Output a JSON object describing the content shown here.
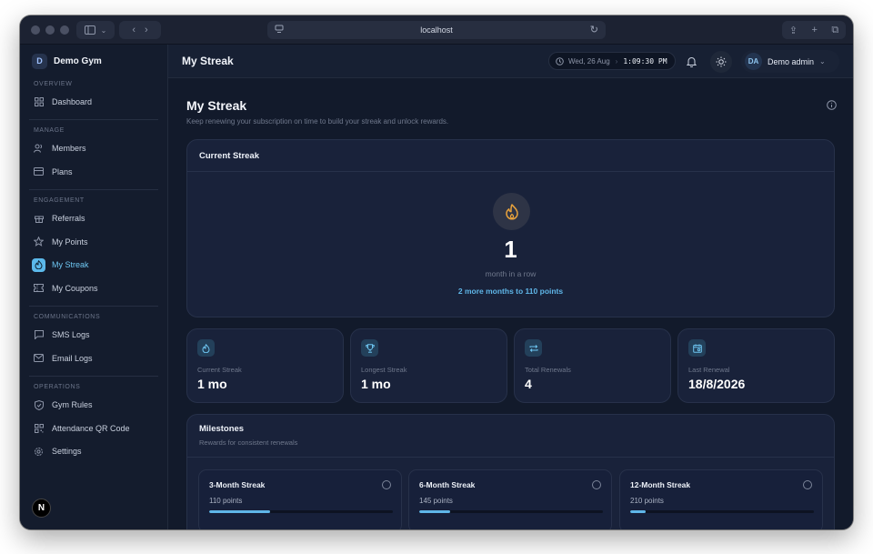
{
  "browser": {
    "url": "localhost"
  },
  "sidebar": {
    "brand_initial": "D",
    "brand_name": "Demo Gym",
    "sections": {
      "overview": "OVERVIEW",
      "manage": "MANAGE",
      "engagement": "ENGAGEMENT",
      "communications": "COMMUNICATIONS",
      "operations": "OPERATIONS"
    },
    "items": {
      "dashboard": "Dashboard",
      "members": "Members",
      "plans": "Plans",
      "referrals": "Referrals",
      "my_points": "My Points",
      "my_streak": "My Streak",
      "my_coupons": "My Coupons",
      "sms_logs": "SMS Logs",
      "email_logs": "Email Logs",
      "gym_rules": "Gym Rules",
      "attendance_qr": "Attendance QR Code",
      "settings": "Settings"
    },
    "active_item": "My Streak",
    "footer_avatar": "N"
  },
  "topbar": {
    "title": "My Streak",
    "date": "Wed, 26 Aug",
    "time": "1:09:30 PM",
    "user_initials": "DA",
    "user_name": "Demo admin"
  },
  "page": {
    "title": "My Streak",
    "subtitle": "Keep renewing your subscription on time to build your streak and unlock rewards."
  },
  "current_streak": {
    "header": "Current Streak",
    "value": "1",
    "unit": "month in a row",
    "next_reward": "2 more months to 110 points"
  },
  "stats": [
    {
      "label": "Current Streak",
      "value": "1 mo",
      "icon": "flame-icon"
    },
    {
      "label": "Longest Streak",
      "value": "1 mo",
      "icon": "trophy-icon"
    },
    {
      "label": "Total Renewals",
      "value": "4",
      "icon": "repeat-icon"
    },
    {
      "label": "Last Renewal",
      "value": "18/8/2026",
      "icon": "calendar-icon"
    }
  ],
  "milestones": {
    "title": "Milestones",
    "subtitle": "Rewards for consistent renewals",
    "items": [
      {
        "name": "3-Month Streak",
        "points": "110 points",
        "progress": 0.333
      },
      {
        "name": "6-Month Streak",
        "points": "145 points",
        "progress": 0.167
      },
      {
        "name": "12-Month Streak",
        "points": "210 points",
        "progress": 0.083
      }
    ]
  },
  "colors": {
    "accent": "#5fb6e8",
    "background": "#121a2b",
    "card": "#19223a",
    "flame": "#e8a23c"
  }
}
